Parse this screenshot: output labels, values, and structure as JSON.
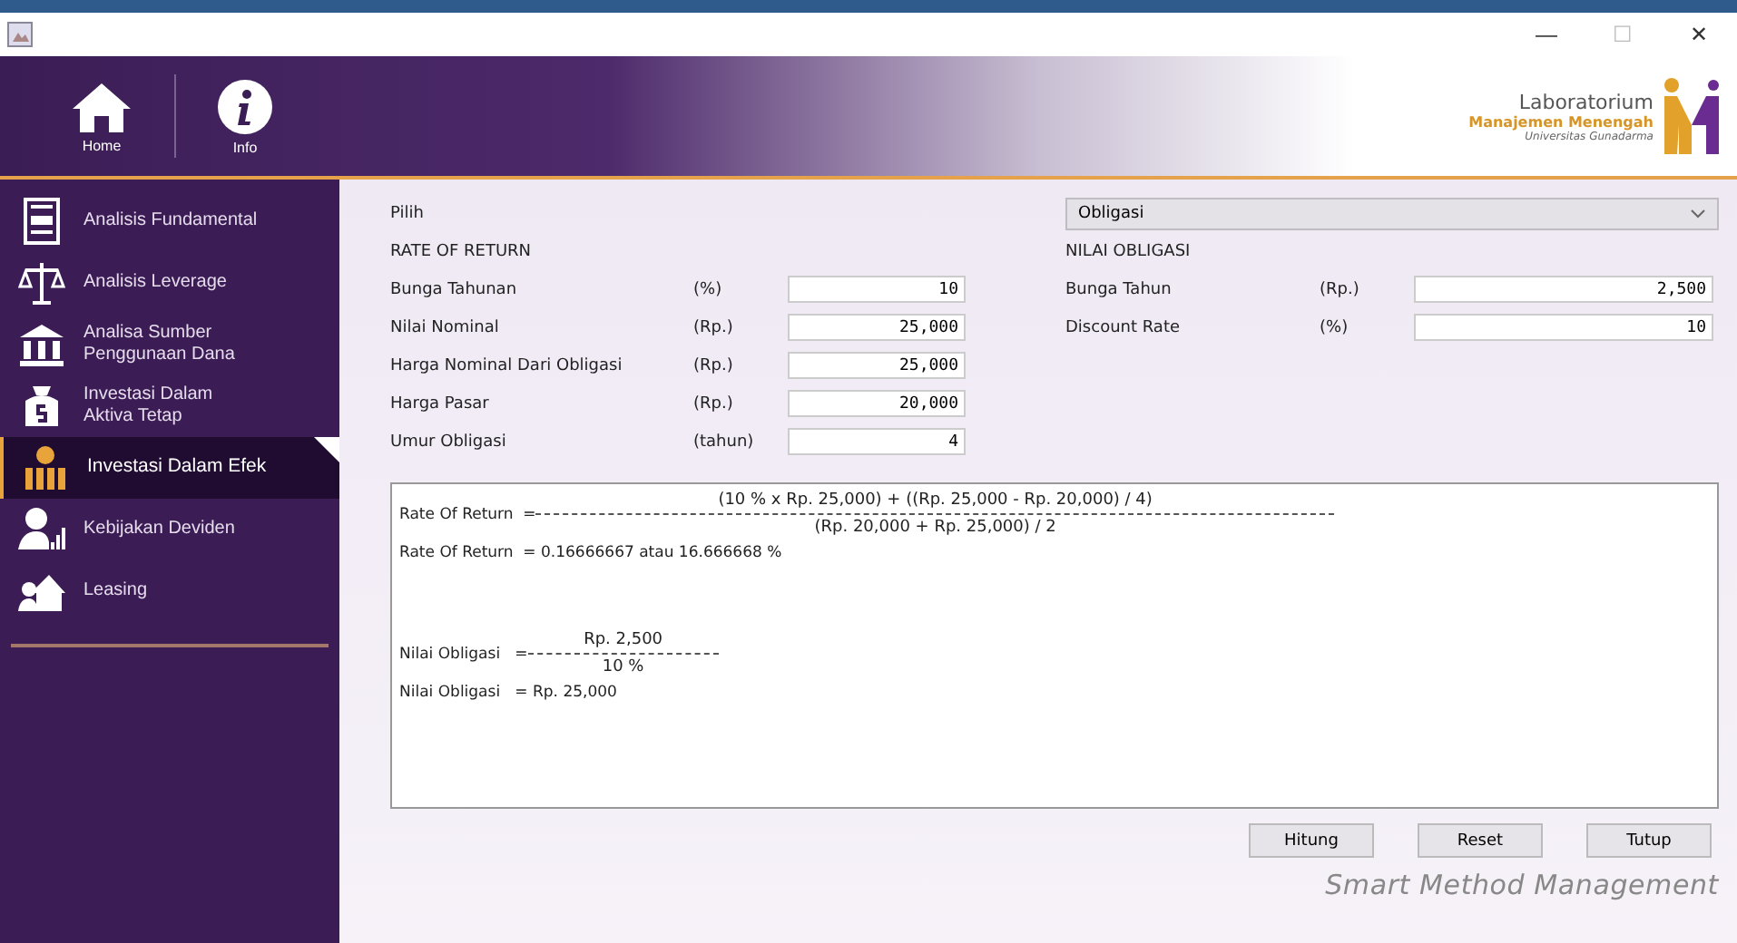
{
  "window": {
    "controls": [
      "—",
      "☐",
      "✕"
    ]
  },
  "header": {
    "nav": [
      {
        "label": "Home"
      },
      {
        "label": "Info"
      }
    ],
    "logo": {
      "line1": "Laboratorium",
      "line2": "Manajemen Menengah",
      "line3": "Universitas Gunadarma"
    }
  },
  "sidebar": {
    "items": [
      {
        "label": "Analisis Fundamental",
        "selected": false
      },
      {
        "label": "Analisis Leverage",
        "selected": false
      },
      {
        "label": "Analisa Sumber Penggunaan Dana",
        "selected": false
      },
      {
        "label": "Investasi Dalam Aktiva Tetap",
        "selected": false
      },
      {
        "label": "Investasi Dalam Efek",
        "selected": true
      },
      {
        "label": "Kebijakan Deviden",
        "selected": false
      },
      {
        "label": "Leasing",
        "selected": false
      }
    ]
  },
  "form": {
    "pick_label": "Pilih",
    "pick_value": "Obligasi",
    "left": {
      "title": "RATE OF RETURN",
      "fields": [
        {
          "label": "Bunga Tahunan",
          "unit": "(%)",
          "value": "10"
        },
        {
          "label": "Nilai Nominal",
          "unit": "(Rp.)",
          "value": "25,000"
        },
        {
          "label": "Harga Nominal Dari Obligasi",
          "unit": "(Rp.)",
          "value": "25,000"
        },
        {
          "label": "Harga Pasar",
          "unit": "(Rp.)",
          "value": "20,000"
        },
        {
          "label": "Umur Obligasi",
          "unit": "(tahun)",
          "value": "4"
        }
      ]
    },
    "right": {
      "title": "NILAI OBLIGASI",
      "fields": [
        {
          "label": "Bunga Tahun",
          "unit": "(Rp.)",
          "value": "2,500"
        },
        {
          "label": "Discount Rate",
          "unit": "(%)",
          "value": "10"
        }
      ]
    }
  },
  "result": {
    "ror_label": "Rate Of Return  =",
    "ror_numerator": "(10 % x Rp. 25,000) + ((Rp. 25,000 - Rp. 20,000) / 4)",
    "ror_denominator": "(Rp. 20,000 + Rp. 25,000) / 2",
    "ror_result": "Rate Of Return  = 0.16666667 atau 16.666668 %",
    "nilai_label": "Nilai Obligasi   =",
    "nilai_numerator": "Rp. 2,500",
    "nilai_denominator": "10 %",
    "nilai_result": "Nilai Obligasi   = Rp. 25,000"
  },
  "buttons": [
    "Hitung",
    "Reset",
    "Tutup"
  ],
  "footer": "Smart Method Management"
}
